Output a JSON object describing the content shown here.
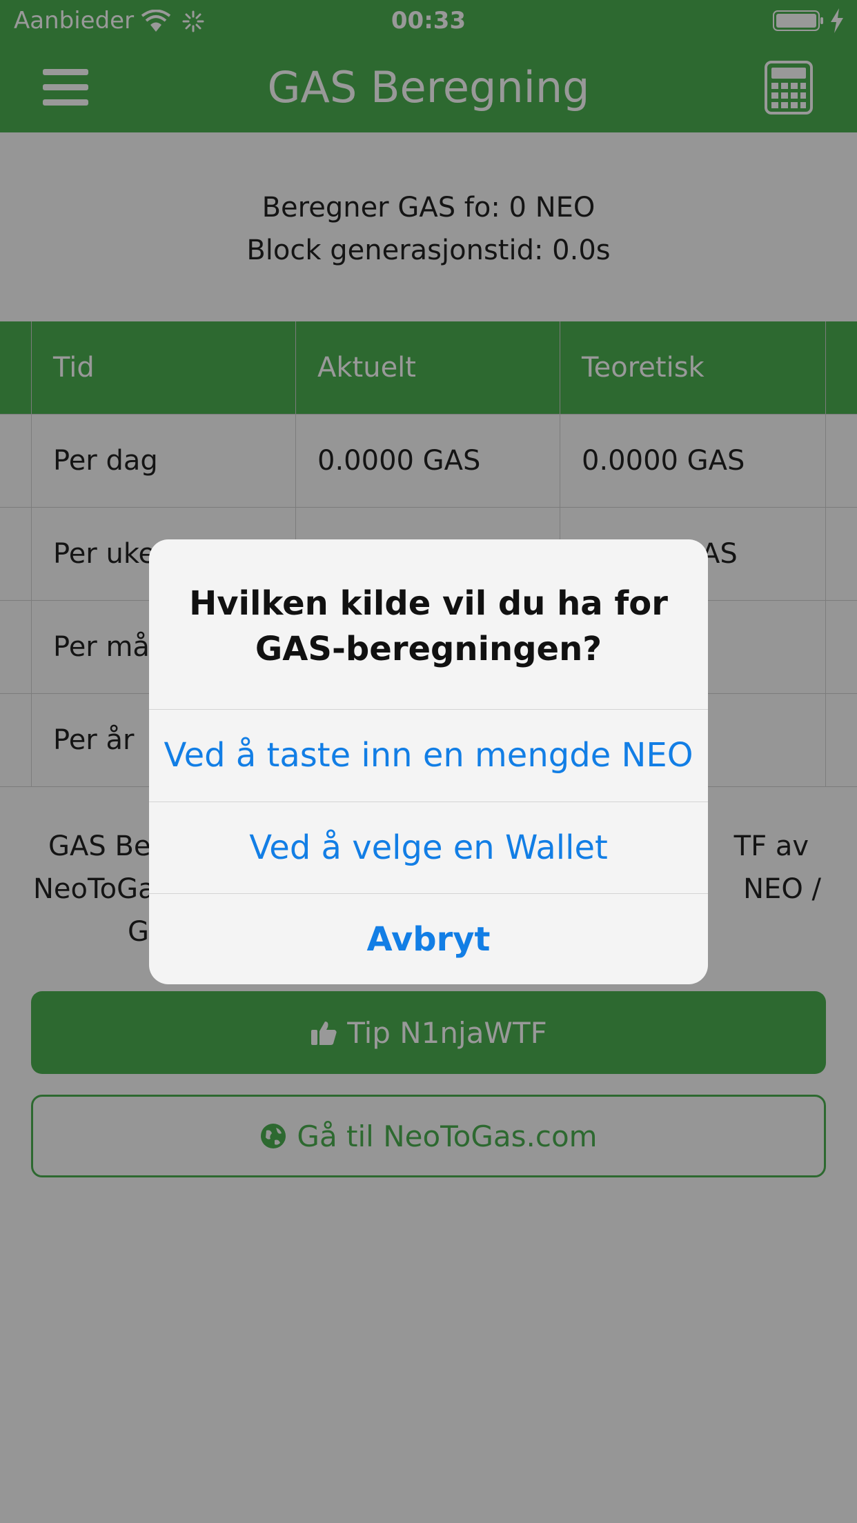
{
  "status_bar": {
    "carrier": "Aanbieder",
    "time": "00:33"
  },
  "nav": {
    "title": "GAS Beregning",
    "left_icon": "menu-icon",
    "right_icon": "calculator-icon"
  },
  "info": {
    "line1": "Beregner GAS fo: 0 NEO",
    "line2": "Block generasjonstid: 0.0s"
  },
  "table": {
    "headers": [
      "Tid",
      "Aktuelt",
      "Teoretisk"
    ],
    "rows": [
      [
        "Per dag",
        "0.0000 GAS",
        "0.0000 GAS"
      ],
      [
        "Per uke",
        "",
        "AS"
      ],
      [
        "Per mån",
        "",
        ""
      ],
      [
        "Per år",
        "",
        ""
      ]
    ]
  },
  "credit": {
    "line1_left": "GAS Ber",
    "line1_right": "TF av",
    "line2_left": "NeoToGa",
    "line2_right": "NEO /",
    "line3_left": "G"
  },
  "buttons": {
    "tip": "Tip N1njaWTF",
    "site": "Gå til NeoToGas.com"
  },
  "alert": {
    "title": "Hvilken kilde vil du ha for GAS-beregningen?",
    "option1": "Ved å taste inn en mengde NEO",
    "option2": "Ved å velge en Wallet",
    "cancel": "Avbryt"
  },
  "colors": {
    "brand_green": "#4caf50",
    "link_blue": "#127ee5"
  }
}
